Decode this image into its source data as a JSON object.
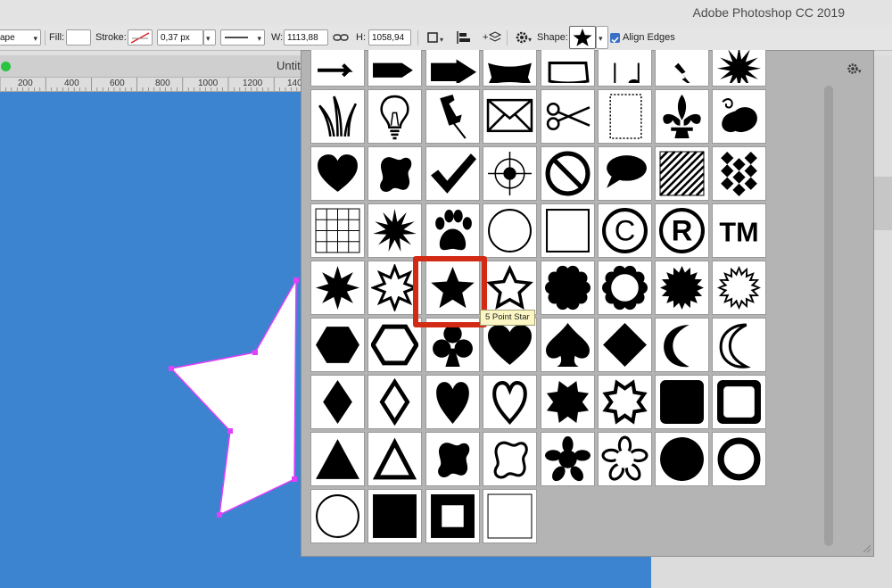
{
  "app": {
    "title": "Adobe Photoshop CC 2019"
  },
  "options_bar": {
    "mode_value": "ape",
    "fill_label": "Fill:",
    "stroke_label": "Stroke:",
    "stroke_width_value": "0,37 px",
    "width_label": "W:",
    "width_value": "1113,88",
    "height_label": "H:",
    "height_value": "1058,94",
    "shape_label": "Shape:",
    "align_edges_label": "Align Edges",
    "align_edges_checked": true
  },
  "document": {
    "tab_title": "Untit"
  },
  "ruler": {
    "labels": [
      "200",
      "400",
      "600",
      "800",
      "1000",
      "1200",
      "140"
    ]
  },
  "shape_picker": {
    "tooltip": "5 Point Star",
    "selected_shape": "5 Point Star",
    "highlight_color": "#d22a14",
    "canvas_color": "#3c83d0",
    "rows": [
      [
        "arrow-icon",
        "bold-arrow-icon",
        "big-arrow-icon",
        "banner-icon",
        "frame-icon",
        "music-notes-icon",
        "lightning-icon",
        "splat-icon"
      ],
      [
        "grass-icon",
        "light-bulb-icon",
        "pushpin-icon",
        "envelope-icon",
        "scissors-icon",
        "stamp-icon",
        "fleur-de-lis-icon",
        "ornament-icon"
      ],
      [
        "heart-icon",
        "blob-icon",
        "checkmark-icon",
        "target-icon",
        "no-sign-icon",
        "speech-bubble-icon",
        "diagonal-lines-icon",
        "checkerboard-icon"
      ],
      [
        "grid-icon",
        "starburst-icon",
        "paw-print-icon",
        "circle-outline-icon",
        "square-outline-icon",
        "copyright-icon",
        "registered-icon",
        "trademark-icon"
      ],
      [
        "8-point-star-icon",
        "8-point-star-outline-icon",
        "5-point-star-icon",
        "5-point-star-outline-icon",
        "scalloped-circle-icon",
        "scalloped-circle-outline-icon",
        "seal-icon",
        "seal-outline-icon"
      ],
      [
        "hexagon-icon",
        "hexagon-outline-icon",
        "club-icon",
        "heart-card-icon",
        "spade-icon",
        "diamond-card-icon",
        "crescent-moon-icon",
        "crescent-moon-outline-icon"
      ],
      [
        "diamond-icon",
        "diamond-outline-icon",
        "tall-heart-icon",
        "tall-heart-outline-icon",
        "star-burst-8-icon",
        "star-burst-8-outline-icon",
        "rounded-square-icon",
        "rounded-square-outline-icon"
      ],
      [
        "triangle-icon",
        "triangle-outline-icon",
        "blob-2-icon",
        "blob-outline-icon",
        "flower-icon",
        "flower-outline-icon",
        "circle-icon",
        "ring-icon"
      ],
      [
        "circle-thin-outline-icon",
        "filled-square-icon",
        "square-frame-icon",
        "thin-square-icon"
      ]
    ],
    "selected_row": 4,
    "selected_col": 2
  }
}
